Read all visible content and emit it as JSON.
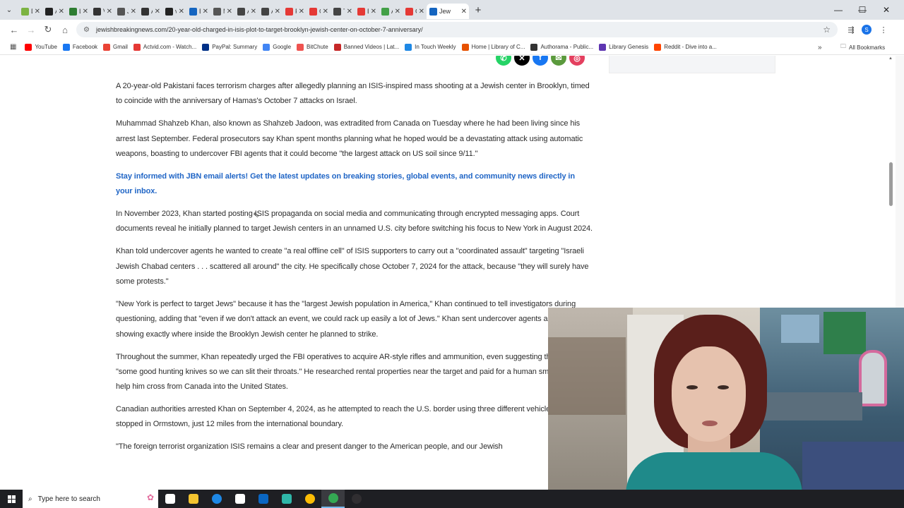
{
  "browser": {
    "tabs": [
      {
        "title": "Dov",
        "color": "#7cb342",
        "active": false
      },
      {
        "title": "Ani",
        "color": "#222222",
        "active": false
      },
      {
        "title": "Léo",
        "color": "#2e7d32",
        "active": false
      },
      {
        "title": "Vay",
        "color": "#333333",
        "active": false
      },
      {
        "title": "Jew",
        "color": "#555555",
        "active": false
      },
      {
        "title": "Ani",
        "color": "#333333",
        "active": false
      },
      {
        "title": "vie",
        "color": "#222222",
        "active": false
      },
      {
        "title": "Evic",
        "color": "#1565c0",
        "active": false
      },
      {
        "title": "My",
        "color": "#555555",
        "active": false
      },
      {
        "title": "A re",
        "color": "#444444",
        "active": false
      },
      {
        "title": "Ant",
        "color": "#444444",
        "active": false
      },
      {
        "title": "Full",
        "color": "#e53935",
        "active": false
      },
      {
        "title": "Gre",
        "color": "#e53935",
        "active": false
      },
      {
        "title": "The",
        "color": "#444444",
        "active": false
      },
      {
        "title": "Elin",
        "color": "#e53935",
        "active": false
      },
      {
        "title": "All",
        "color": "#43a047",
        "active": false
      },
      {
        "title": "Gre",
        "color": "#e53935",
        "active": false
      },
      {
        "title": "Jew",
        "color": "#1565c0",
        "active": true
      }
    ],
    "url": "jewishbreakingnews.com/20-year-old-charged-in-isis-plot-to-target-brooklyn-jewish-center-on-october-7-anniversary/",
    "profile_initial": "S",
    "bookmarks": [
      {
        "label": "YouTube",
        "color": "#ff0000"
      },
      {
        "label": "Facebook",
        "color": "#1877f2"
      },
      {
        "label": "Gmail",
        "color": "#ea4335"
      },
      {
        "label": "Actvid.com - Watch...",
        "color": "#e53935"
      },
      {
        "label": "PayPal: Summary",
        "color": "#003087"
      },
      {
        "label": "Google",
        "color": "#4285f4"
      },
      {
        "label": "BitChute",
        "color": "#ef5350"
      },
      {
        "label": "Banned Videos | Lat...",
        "color": "#c62828"
      },
      {
        "label": "In Touch Weekly",
        "color": "#1e88e5"
      },
      {
        "label": "Home | Library of C...",
        "color": "#e65100"
      },
      {
        "label": "Authorama - Public...",
        "color": "#333333"
      },
      {
        "label": "Library Genesis",
        "color": "#5e35b1"
      },
      {
        "label": "Reddit - Dive into a...",
        "color": "#ff4500"
      }
    ],
    "all_bookmarks_label": "All Bookmarks"
  },
  "article": {
    "paragraphs": [
      "A 20-year-old Pakistani faces terrorism charges after allegedly planning an ISIS-inspired mass shooting at a Jewish center in Brooklyn, timed to coincide with the anniversary of Hamas's October 7 attacks on Israel.",
      "Muhammad Shahzeb Khan, also known as Shahzeb Jadoon, was extradited from Canada on Tuesday where he had been living since his arrest last September. Federal prosecutors say Khan spent months planning what he hoped would be a devastating attack using automatic weapons, boasting to undercover FBI agents that it could become \"the largest attack on US soil since 9/11.\"",
      "Stay informed with JBN email alerts! Get the latest updates on breaking stories, global events, and community news directly in your inbox.",
      "In November 2023, Khan started posting ISIS propaganda on social media and communicating through encrypted messaging apps. Court documents reveal he initially planned to target Jewish centers in an unnamed U.S. city before switching his focus to New York in August 2024.",
      "Khan told undercover agents he wanted to create \"a real offline cell\" of ISIS supporters to carry out a \"coordinated assault\" targeting \"Israeli Jewish Chabad centers . . . scattered all around\" the city. He specifically chose October 7, 2024 for the attack, because \"they will surely have some protests.\"",
      " \"New York is perfect to target Jews\" because it has the \"largest Jewish population in America,\" Khan continued to tell investigators during questioning, adding that \"even if we don't attack an event, we could rack up easily a lot of Jews.\" Khan sent undercover agents a photograph showing exactly where inside the Brooklyn Jewish center he planned to strike.",
      "Throughout the summer, Khan repeatedly urged the FBI operatives to acquire AR-style rifles and ammunition, even suggesting they obtain \"some good hunting knives so we can slit their throats.\" He researched rental properties near the target and paid for a human smuggler to help him cross from Canada into the United States.",
      "Canadian authorities arrested Khan on September 4, 2024, as he attempted to reach the U.S. border using three different vehicles. He was stopped in Ormstown, just 12 miles from the international boundary.",
      "\"The foreign terrorist organization ISIS remains a clear and present danger to the American people, and our Jewish"
    ],
    "cta_index": 2,
    "share_icons": [
      {
        "name": "whatsapp-icon",
        "glyph": "✆",
        "color": "#25d366"
      },
      {
        "name": "x-icon",
        "glyph": "✕",
        "color": "#000000"
      },
      {
        "name": "facebook-icon",
        "glyph": "f",
        "color": "#1877f2"
      },
      {
        "name": "email-icon",
        "glyph": "✉",
        "color": "#5b9a3d"
      },
      {
        "name": "instagram-icon",
        "glyph": "◎",
        "color": "#e4405f"
      }
    ]
  },
  "taskbar": {
    "search_placeholder": "Type here to search",
    "apps": [
      {
        "name": "task-view-icon",
        "color": "#ffffff"
      },
      {
        "name": "file-explorer-icon",
        "color": "#f4c430"
      },
      {
        "name": "edge-icon",
        "color": "#1e88e5"
      },
      {
        "name": "store-icon",
        "color": "#ffffff"
      },
      {
        "name": "outlook-icon",
        "color": "#0a66c2"
      },
      {
        "name": "app-icon",
        "color": "#2fb7a9"
      },
      {
        "name": "chrome-icon",
        "color": "#fbbc05"
      },
      {
        "name": "chrome-active-icon",
        "color": "#34a853"
      },
      {
        "name": "obs-icon",
        "color": "#302e31"
      }
    ]
  }
}
